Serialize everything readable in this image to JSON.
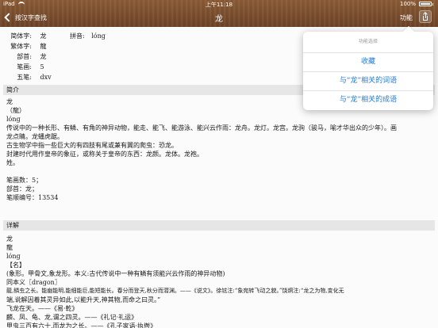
{
  "status_bar": {
    "time": "上午11:18",
    "battery": "100%"
  },
  "nav": {
    "back_label": "按汉字查找",
    "title": "龙",
    "function_label": "功能"
  },
  "basic": {
    "jianti_label": "简体字:",
    "jianti_value": "龙",
    "pinyin_label": "拼音:",
    "pinyin_value": "lóng",
    "fanti_label": "繁体字:",
    "fanti_value": "龍",
    "bushou_label": "部首:",
    "bushou_value": "龙",
    "bihua_label": "笔画:",
    "bihua_value": "5",
    "wubi_label": "五笔:",
    "wubi_value": "dxv"
  },
  "intro": {
    "header": "简介",
    "lines": [
      "龙",
      "（龍）",
      "lóng",
      "传说中的一种长形、有鳞、有角的神异动物，能走、能飞、能游泳、能兴云作雨：龙舟。龙灯。龙宫。龙驹（骏马，喻才华出众的少年）。画",
      "龙点睛。龙蟠虎踞。",
      "古生物学中指一些巨大的有四肢有尾或兼有翼的爬虫：恐龙。",
      "封建时代用作皇帝的象征，或称关于皇帝的东西：龙颜。龙体。龙袍。",
      "姓。",
      "",
      "笔画数：5；",
      "部首：龙；",
      "笔顺编号：13534"
    ]
  },
  "detail": {
    "header": "详解",
    "lines": [
      "龙",
      "龍",
      "lóng",
      "【名】",
      "(象形。甲骨文,象龙形。本义:古代传说中一种有鳞有须能兴云作雨的神异动物)",
      "同本义〖dragon〗",
      "龍,鳞虫之长。能幽能明,能细能巨,能短能长。春分而登天,秋分而潜渊。——《说文》。徐铉注:“象宛转飞动之貌。”饶炯注:“龙之为物,变化无",
      "端,说解因着其灵异如此,以能升天,神其物,而命之曰灵。”",
      "飞龙在天。——《易·乾》",
      "麟、凤、龟、龙,谓之四灵。——《礼记·礼运》",
      "甲虫三百有六十,而龙为之长。——《孔子家语·执辔》"
    ]
  },
  "popover": {
    "title": "功能选择",
    "items": [
      "收藏",
      "与“龙”相关的词语",
      "与“龙”相关的成语"
    ]
  },
  "colors": {
    "link_blue": "#2a7bd4",
    "wood_brown": "#7a4d2c",
    "section_gray": "#e6e6e6"
  }
}
